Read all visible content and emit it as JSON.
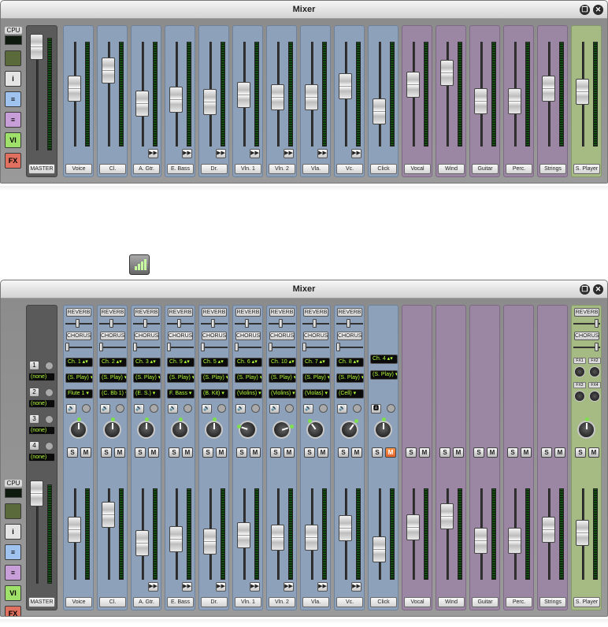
{
  "window_title": "Mixer",
  "cpu_label": "CPU",
  "master_label": "MASTER",
  "tools": [
    {
      "name": "meter",
      "label": "",
      "color": "#5a6a3a"
    },
    {
      "name": "info",
      "label": "i",
      "color": "#e4e4e4"
    },
    {
      "name": "list",
      "label": "≡",
      "color": "#9fc2ef"
    },
    {
      "name": "notes",
      "label": "≡",
      "color": "#c79ed7"
    },
    {
      "name": "vi",
      "label": "VI",
      "color": "#9fe06a"
    },
    {
      "name": "fx",
      "label": "FX",
      "color": "#e07060"
    }
  ],
  "channels": [
    {
      "label": "Voice",
      "color": "blue",
      "level": 0.62,
      "play": false,
      "ch": "Ch. 1",
      "player": "(S. Play)",
      "sound": "Flute 1",
      "pan": 0.5
    },
    {
      "label": "Cl.",
      "color": "blue",
      "level": 0.82,
      "play": false,
      "ch": "Ch. 2",
      "player": "(S. Play)",
      "sound": "(C. Bb 1)",
      "pan": 0.5
    },
    {
      "label": "A. Gtr.",
      "color": "blue",
      "level": 0.45,
      "play": true,
      "ch": "Ch. 3",
      "player": "(S. Play)",
      "sound": "(E. S.)",
      "pan": 0.5
    },
    {
      "label": "E. Bass",
      "color": "blue",
      "level": 0.5,
      "play": true,
      "ch": "Ch. 9",
      "player": "(S. Play)",
      "sound": "F. Bass",
      "pan": 0.5
    },
    {
      "label": "Dr.",
      "color": "blue",
      "level": 0.47,
      "play": true,
      "ch": "Ch. 5",
      "player": "(S. Play)",
      "sound": "(B. Kit)",
      "pan": 0.5
    },
    {
      "label": "Vln. 1",
      "color": "blue",
      "level": 0.55,
      "play": true,
      "ch": "Ch. 6",
      "player": "(S. Play)",
      "sound": "(Violins)",
      "pan": 0.2
    },
    {
      "label": "Vln. 2",
      "color": "blue",
      "level": 0.52,
      "play": true,
      "ch": "Ch. 10",
      "player": "(S. Play)",
      "sound": "(Violins)",
      "pan": 0.8
    },
    {
      "label": "Vla.",
      "color": "blue",
      "level": 0.52,
      "play": true,
      "ch": "Ch. 7",
      "player": "(S. Play)",
      "sound": "(Violas)",
      "pan": 0.35
    },
    {
      "label": "Vc.",
      "color": "blue",
      "level": 0.65,
      "play": true,
      "ch": "Ch. 8",
      "player": "(S. Play)",
      "sound": "(Cell)",
      "pan": 0.65
    },
    {
      "label": "Click",
      "color": "blue",
      "level": 0.36,
      "play": false,
      "ch": "Ch. 4",
      "player": "(S. Play)",
      "sound": "",
      "pan": 0.5,
      "click": true
    },
    {
      "label": "Vocal",
      "color": "purple",
      "level": 0.66,
      "play": false
    },
    {
      "label": "Wind",
      "color": "purple",
      "level": 0.8,
      "play": false
    },
    {
      "label": "Guitar",
      "color": "purple",
      "level": 0.48,
      "play": false
    },
    {
      "label": "Perc.",
      "color": "purple",
      "level": 0.48,
      "play": false
    },
    {
      "label": "Strings",
      "color": "purple",
      "level": 0.62,
      "play": false
    },
    {
      "label": "S. Player",
      "color": "green",
      "level": 0.58,
      "play": false
    }
  ],
  "sends": {
    "reverb": "REVERB",
    "chorus": "CHORUS"
  },
  "fx_labels": [
    "FX1",
    "FX2",
    "FX3",
    "FX4"
  ],
  "solo": "S",
  "mute": "M",
  "inserts": [
    {
      "num": "1",
      "value": "(none)"
    },
    {
      "num": "2",
      "value": "(none)"
    },
    {
      "num": "3",
      "value": "(none)"
    },
    {
      "num": "4",
      "value": "(none)"
    }
  ]
}
